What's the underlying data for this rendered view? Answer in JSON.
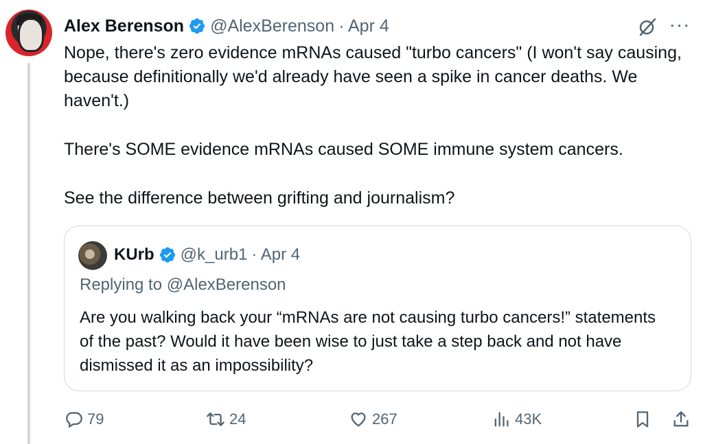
{
  "tweet": {
    "author_name": "Alex Berenson",
    "handle": "@AlexBerenson",
    "date": "· Apr 4",
    "paragraphs": [
      "Nope, there's zero evidence mRNAs caused \"turbo cancers\" (I won't say causing, because definitionally we'd already have seen a spike in cancer deaths. We haven't.)",
      "There's SOME evidence mRNAs caused SOME immune system cancers.",
      "See the difference between grifting and journalism?"
    ]
  },
  "quote": {
    "author_name": "KUrb",
    "handle": "@k_urb1",
    "date": "· Apr 4",
    "replying_to": "Replying to @AlexBerenson",
    "text": "Are you walking back your “mRNAs are not causing turbo cancers!” statements of the past? Would it have been wise to just take a step back and not have dismissed it as an impossibility?"
  },
  "actions": {
    "replies": "79",
    "reposts": "24",
    "likes": "267",
    "views": "43K"
  },
  "icons": {
    "reply": "reply-icon",
    "repost": "repost-icon",
    "like": "heart-icon",
    "views": "views-icon",
    "bookmark": "bookmark-icon",
    "share": "share-icon",
    "verified": "verified-badge-icon",
    "grok": "grok-icon",
    "more": "more-icon"
  },
  "colors": {
    "verified": "#1d9bf0",
    "text": "#0f1419",
    "muted": "#536471",
    "border": "#cfd9de"
  }
}
